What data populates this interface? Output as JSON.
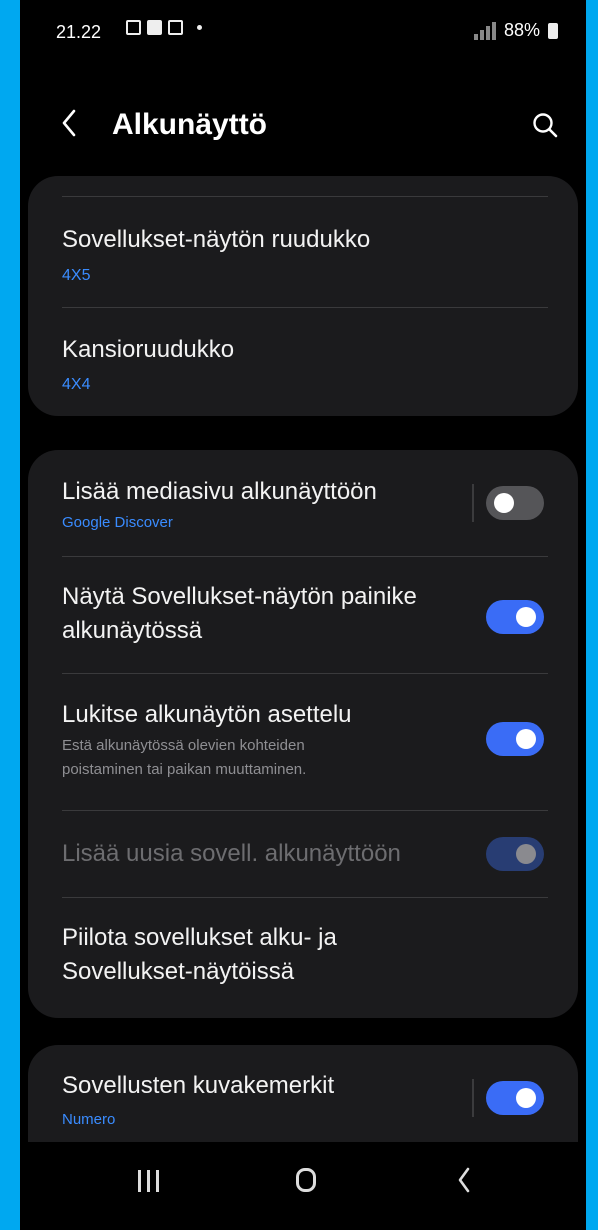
{
  "status_bar": {
    "time": "21.22",
    "battery": "88%"
  },
  "app_bar": {
    "title": "Alkunäyttö",
    "back_icon": "chevron-left-icon",
    "search_icon": "search-icon"
  },
  "group1": {
    "apps_grid": {
      "title": "Sovellukset-näytön ruudukko",
      "value": "4X5"
    },
    "folder_grid": {
      "title": "Kansioruudukko",
      "value": "4X4"
    }
  },
  "group2": {
    "media_page": {
      "title": "Lisää mediasivu alkunäyttöön",
      "subtitle": "Google Discover",
      "enabled": false
    },
    "apps_button": {
      "title_line1": "Näytä Sovellukset-näytön painike",
      "title_line2": "alkunäytössä",
      "enabled": true
    },
    "lock_layout": {
      "title": "Lukitse alkunäytön asettelu",
      "desc_line1": "Estä alkunäytössä olevien kohteiden",
      "desc_line2": "poistaminen tai paikan muuttaminen.",
      "enabled": true
    },
    "add_new_apps": {
      "title": "Lisää uusia sovell. alkunäyttöön",
      "enabled": true,
      "disabled": true
    },
    "hide_apps": {
      "title_line1": "Piilota sovellukset alku- ja",
      "title_line2": "Sovellukset-näytöissä"
    }
  },
  "group3": {
    "badges": {
      "title": "Sovellusten kuvakemerkit",
      "subtitle": "Numero",
      "enabled": true
    }
  },
  "nav": {
    "recent_icon": "recent-apps-icon",
    "home_icon": "home-icon",
    "back_icon": "back-icon"
  },
  "colors": {
    "accent": "#3a6cf6",
    "link": "#3a8cff",
    "card": "#1b1b1d",
    "frame": "#00A8F0"
  }
}
